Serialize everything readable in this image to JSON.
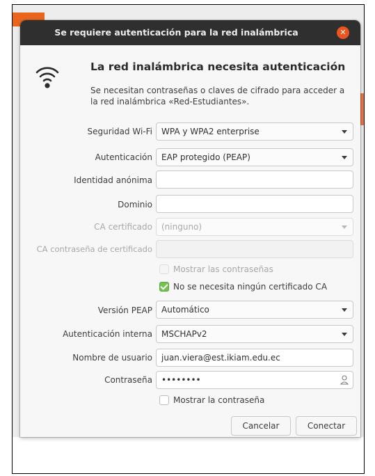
{
  "window": {
    "title": "Se requiere autenticación para la red inalámbrica",
    "close_glyph": "✕"
  },
  "header": {
    "icon": "wifi-icon",
    "heading": "La red inalámbrica necesita autenticación",
    "description": "Se necesitan contraseñas o claves de cifrado para acceder a la red inalámbrica «Red-Estudiantes»."
  },
  "form": {
    "wifi_security_label": "Seguridad Wi-Fi",
    "wifi_security_value": "WPA y WPA2 enterprise",
    "authentication_label": "Autenticación",
    "authentication_value": "EAP protegido (PEAP)",
    "anonymous_identity_label": "Identidad anónima",
    "anonymous_identity_value": "",
    "domain_label": "Dominio",
    "domain_value": "",
    "ca_certificate_label": "CA certificado",
    "ca_certificate_value": "(ninguno)",
    "ca_cert_password_label": "CA contraseña de certificado",
    "ca_cert_password_value": "",
    "show_passwords_label": "Mostrar las contraseñas",
    "no_ca_cert_label": "No se necesita ningún certificado CA",
    "no_ca_cert_checked": true,
    "peap_version_label": "Versión PEAP",
    "peap_version_value": "Automático",
    "inner_auth_label": "Autenticación interna",
    "inner_auth_value": "MSCHAPv2",
    "username_label": "Nombre de usuario",
    "username_value": "juan.viera@est.ikiam.edu.ec",
    "password_label": "Contraseña",
    "password_value": "••••••••",
    "show_password_label": "Mostrar la contraseña"
  },
  "buttons": {
    "cancel": "Cancelar",
    "connect": "Conectar"
  },
  "colors": {
    "titlebar": "#2f2f2f",
    "accent": "#e95420",
    "check_green": "#73c34e"
  }
}
